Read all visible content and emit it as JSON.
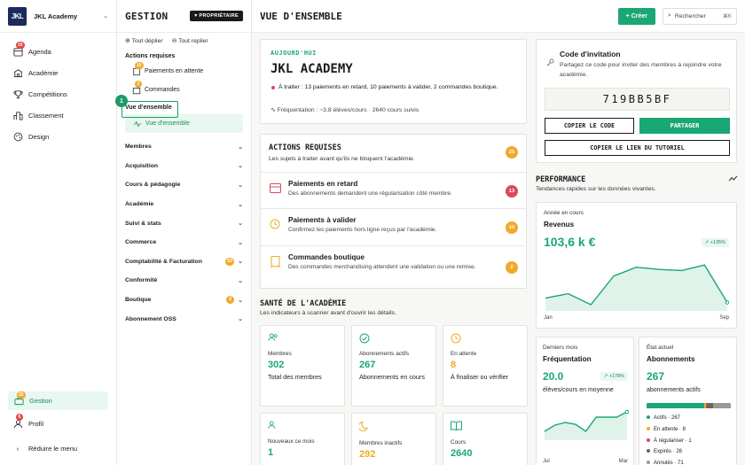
{
  "brand": {
    "logo": "JKL",
    "name": "JKL Academy"
  },
  "nav": {
    "items": [
      {
        "label": "Agenda",
        "icon": "calendar-icon",
        "badge": "19"
      },
      {
        "label": "Académie",
        "icon": "academy-icon",
        "badge": ""
      },
      {
        "label": "Compétitions",
        "icon": "trophy-icon",
        "badge": ""
      },
      {
        "label": "Classement",
        "icon": "ranking-icon",
        "badge": ""
      },
      {
        "label": "Design",
        "icon": "palette-icon",
        "badge": ""
      }
    ],
    "gestion": {
      "label": "Gestion",
      "badge": "25"
    },
    "profil": {
      "label": "Profil",
      "badge": "6"
    },
    "reduce": "Réduire le menu"
  },
  "panel": {
    "title": "GESTION",
    "owner_badge": "PROPRIÉTAIRE",
    "expand_all": "Tout déplier",
    "collapse_all": "Tout replier",
    "required_label": "Actions requises",
    "pending_payments": {
      "label": "Paiements en attente",
      "badge": "10"
    },
    "orders": {
      "label": "Commandes",
      "badge": "2"
    },
    "overview_label": "Vue d'ensemble",
    "overview_sub": "Vue d'ensemble",
    "callout_number": "1",
    "groups": [
      {
        "label": "Membres",
        "badge": ""
      },
      {
        "label": "Acquisition",
        "badge": ""
      },
      {
        "label": "Cours & pédagogie",
        "badge": ""
      },
      {
        "label": "Académie",
        "badge": ""
      },
      {
        "label": "Suivi & stats",
        "badge": ""
      },
      {
        "label": "Commerce",
        "badge": ""
      },
      {
        "label": "Comptabilité & Facturation",
        "badge": "10"
      },
      {
        "label": "Conformité",
        "badge": ""
      },
      {
        "label": "Boutique",
        "badge": "2"
      },
      {
        "label": "Abonnement OSS",
        "badge": ""
      }
    ]
  },
  "topbar": {
    "title": "VUE D'ENSEMBLE",
    "create": "+ Créer",
    "search": "Rechercher",
    "shortcut": "⌘K"
  },
  "today": {
    "eyebrow": "AUJOURD'HUI",
    "title": "JKL ACADEMY",
    "todo": "À traiter : 13 paiements en retard, 10 paiements à valider, 2 commandes boutique.",
    "freq": "Fréquentation : ~3.8 élèves/cours · 2640 cours suivis"
  },
  "actions": {
    "title": "ACTIONS REQUISES",
    "subtitle": "Les sujets à traiter avant qu'ils ne bloquent l'académie.",
    "count": "25",
    "items": [
      {
        "title": "Paiements en retard",
        "desc": "Des abonnements demandent une régularisation côté membre.",
        "badge": "13",
        "color": "#d94a56"
      },
      {
        "title": "Paiements à valider",
        "desc": "Confirmez les paiements hors ligne reçus par l'académie.",
        "badge": "10",
        "color": "#f0a92a"
      },
      {
        "title": "Commandes boutique",
        "desc": "Des commandes merchandising attendent une validation ou une remise.",
        "badge": "2",
        "color": "#f0a92a"
      }
    ]
  },
  "health": {
    "title": "SANTÉ DE L'ACADÉMIE",
    "subtitle": "Les indicateurs à scanner avant d'ouvrir les détails.",
    "cards": [
      {
        "label": "Membres",
        "value": "302",
        "desc": "Total des membres",
        "icon": "members-icon"
      },
      {
        "label": "Abonnements actifs",
        "value": "267",
        "desc": "Abonnements en cours",
        "icon": "check-circle-icon"
      },
      {
        "label": "En attente",
        "value": "8",
        "desc": "À finaliser ou vérifier",
        "icon": "clock-icon"
      },
      {
        "label": "Nouveaux ce mois",
        "value": "1",
        "desc": "",
        "icon": "new-members-icon"
      },
      {
        "label": "Membres inactifs",
        "value": "292",
        "desc": "",
        "icon": "moon-icon"
      },
      {
        "label": "Cours",
        "value": "2640",
        "desc": "",
        "icon": "book-icon"
      }
    ]
  },
  "invite": {
    "title": "Code d'invitation",
    "desc": "Partagez ce code pour inviter des membres à rejoindre votre académie.",
    "code": "719BB5BF",
    "copy": "COPIER LE CODE",
    "share": "PARTAGER",
    "copy_link": "COPIER LE LIEN DU TUTORIEL"
  },
  "performance": {
    "title": "PERFORMANCE",
    "subtitle": "Tendances rapides sur les données vivantes.",
    "revenue": {
      "eyebrow": "Année en cours",
      "label": "Revenus",
      "value": "103,6 k €",
      "delta": "+135%",
      "x_start": "Jan",
      "x_end": "Sep"
    },
    "frequency": {
      "eyebrow": "Derniers mois",
      "label": "Fréquentation",
      "value": "20.0",
      "delta": "+178%",
      "desc": "élèves/cours en moyenne",
      "x_start": "Jul",
      "x_end": "Mar"
    },
    "subs": {
      "eyebrow": "État actuel",
      "label": "Abonnements",
      "value": "267",
      "desc": "abonnements actifs",
      "legend": [
        {
          "label": "Actifs · 267",
          "color": "#1aa773"
        },
        {
          "label": "En attente · 8",
          "color": "#f0a92a"
        },
        {
          "label": "À régulariser · 1",
          "color": "#d94a56"
        },
        {
          "label": "Expirés · 26",
          "color": "#666666"
        },
        {
          "label": "Annulés · 71",
          "color": "#999999"
        }
      ]
    }
  },
  "chart_data": [
    {
      "type": "area",
      "title": "Revenus",
      "x": [
        "Jan",
        "",
        "",
        "",
        "",
        "",
        "",
        "",
        "Sep"
      ],
      "values": [
        10,
        14,
        4,
        30,
        38,
        36,
        35,
        40,
        6
      ],
      "ylim": [
        0,
        45
      ]
    },
    {
      "type": "area",
      "title": "Fréquentation",
      "x": [
        "Jul",
        "",
        "",
        "",
        "",
        "",
        "",
        "",
        "Mar"
      ],
      "values": [
        8,
        15,
        18,
        16,
        8,
        24,
        24,
        24,
        30
      ],
      "ylim": [
        0,
        32
      ]
    }
  ]
}
